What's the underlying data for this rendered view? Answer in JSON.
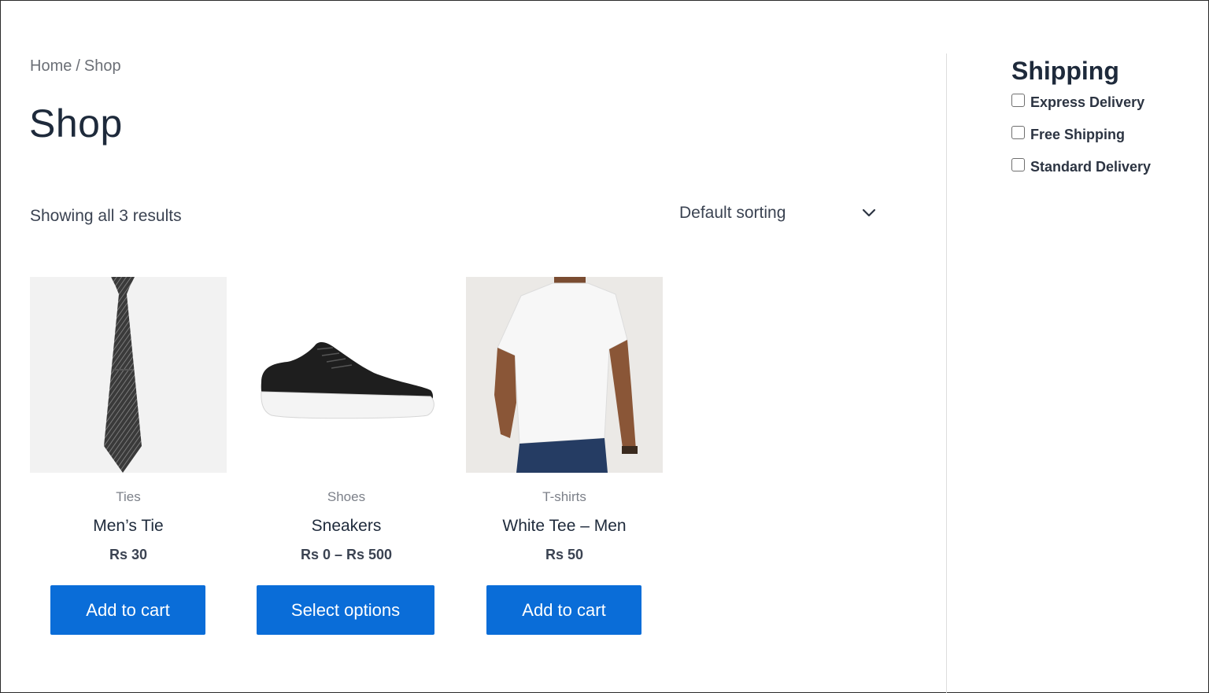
{
  "breadcrumb": {
    "home": "Home",
    "separator": "/",
    "current": "Shop"
  },
  "page": {
    "title": "Shop"
  },
  "results": {
    "text": "Showing all 3 results"
  },
  "ordering": {
    "selected": "Default sorting"
  },
  "products": [
    {
      "category": "Ties",
      "name": "Men’s Tie",
      "price": "Rs 30",
      "button": "Add to cart",
      "image": "necktie"
    },
    {
      "category": "Shoes",
      "name": "Sneakers",
      "price": "Rs 0 – Rs 500",
      "button": "Select options",
      "image": "black-sneaker"
    },
    {
      "category": "T-shirts",
      "name": "White Tee – Men",
      "price": "Rs 50",
      "button": "Add to cart",
      "image": "white-tshirt-man"
    }
  ],
  "sidebar": {
    "title": "Shipping",
    "options": [
      {
        "label": "Express Delivery",
        "checked": false
      },
      {
        "label": "Free Shipping",
        "checked": false
      },
      {
        "label": "Standard Delivery",
        "checked": false
      }
    ]
  },
  "colors": {
    "accent": "#0a6dd8",
    "text": "#1e2a3b",
    "muted": "#7c8089"
  }
}
